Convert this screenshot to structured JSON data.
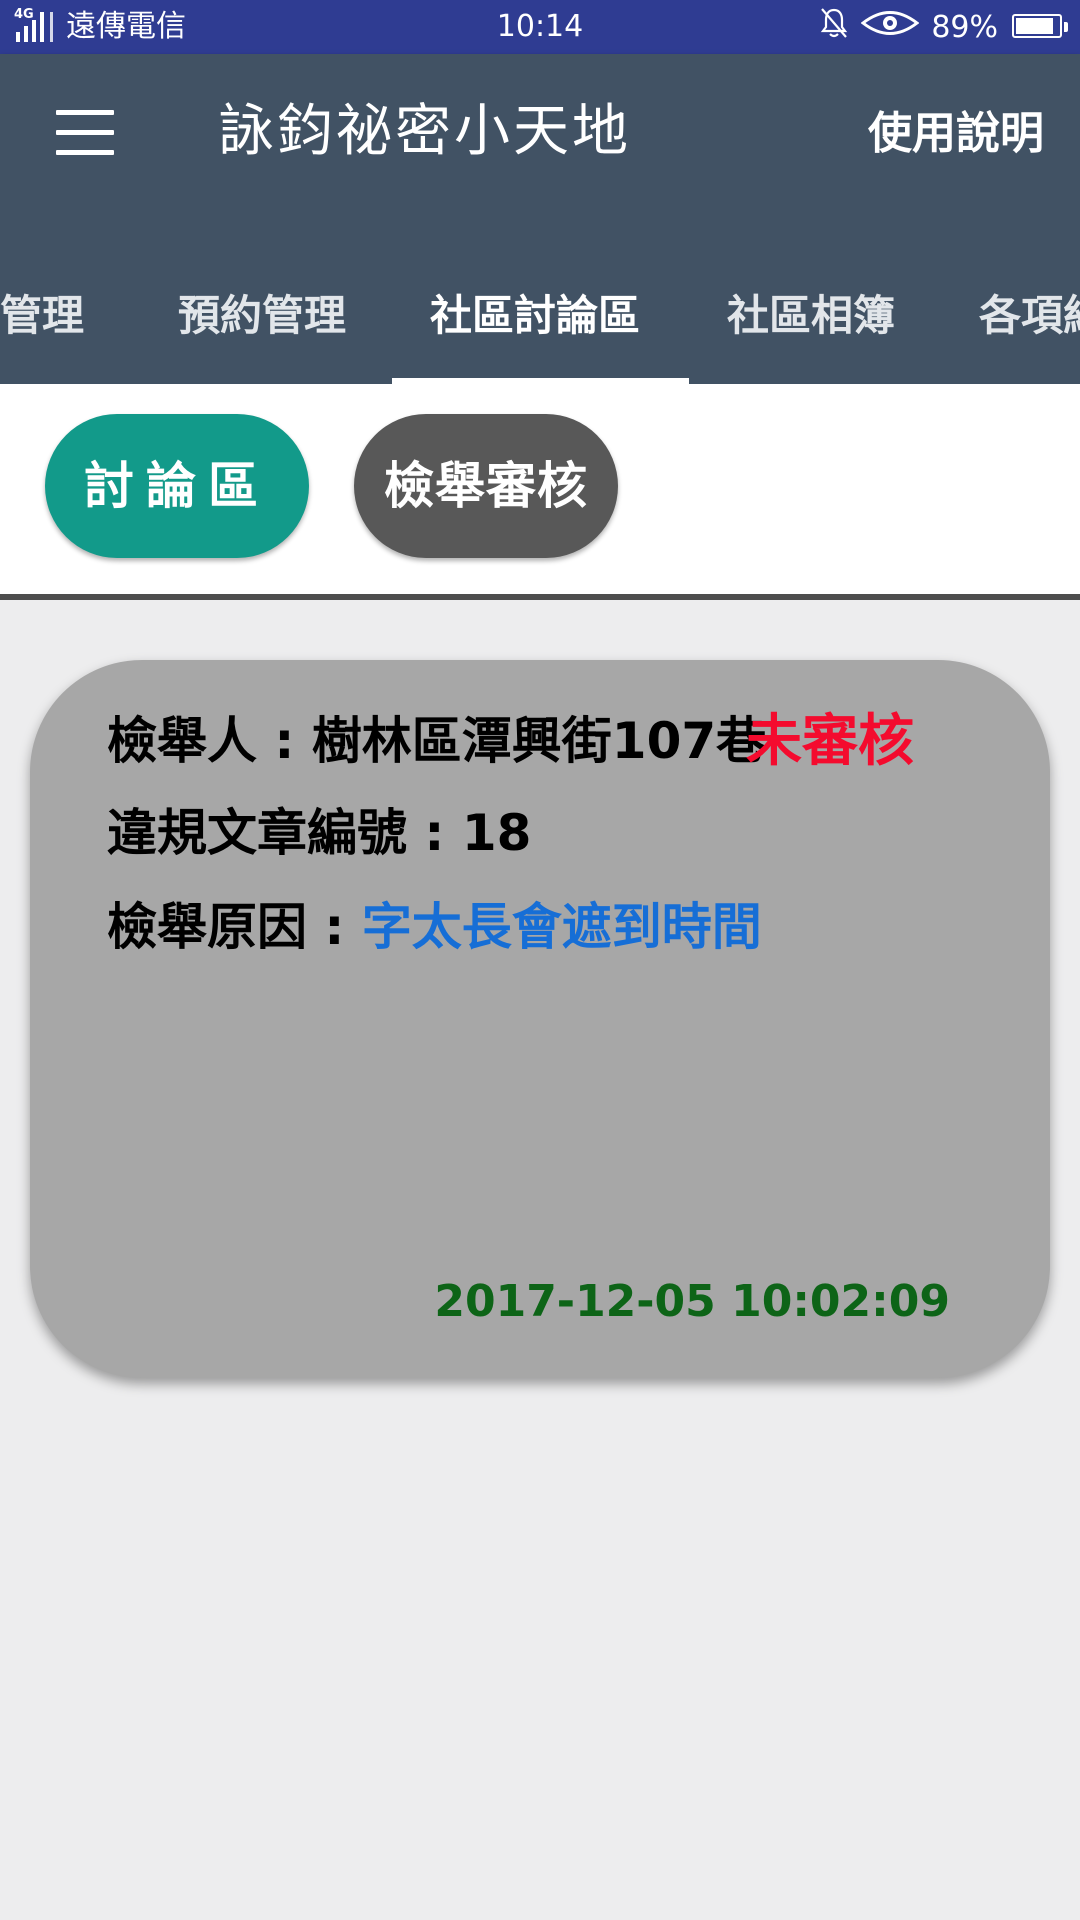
{
  "status_bar": {
    "network": "4G",
    "carrier": "遠傳電信",
    "time": "10:14",
    "battery": "89%",
    "battery_level": 0.89,
    "icons": [
      "signal-icon",
      "bell-off-icon",
      "eye-icon",
      "battery-icon"
    ]
  },
  "app_bar": {
    "title": "詠鈞祕密小天地",
    "help_label": "使用說明",
    "menu_icon": "hamburger-menu-icon"
  },
  "tabs": [
    {
      "label": "報修管理",
      "shown_text": "修管理"
    },
    {
      "label": "預約管理"
    },
    {
      "label": "社區討論區",
      "active": true
    },
    {
      "label": "社區相簿"
    },
    {
      "label": "各項紀",
      "shown_text": "各項紀"
    }
  ],
  "chips": {
    "discussion": "討論區",
    "report_review": "檢舉審核",
    "active_color": "#129a8a",
    "inactive_color": "#585858"
  },
  "report": {
    "reporter_label": "檢舉人 : ",
    "reporter_value": "樹林區潭興街107巷",
    "status": "未審核",
    "article_label": "違規文章編號 : ",
    "article_value": "18",
    "reason_label": "檢舉原因 : ",
    "reason_value": "字太長會遮到時間",
    "timestamp": "2017-12-05 10:02:09",
    "status_color": "#f40b2e",
    "reason_color": "#166ed6",
    "timestamp_color": "#0d6417"
  },
  "colors": {
    "status_bar": "#2f3c92",
    "app_bar": "#415264",
    "background": "#ededee",
    "card": "#a7a7a7"
  }
}
